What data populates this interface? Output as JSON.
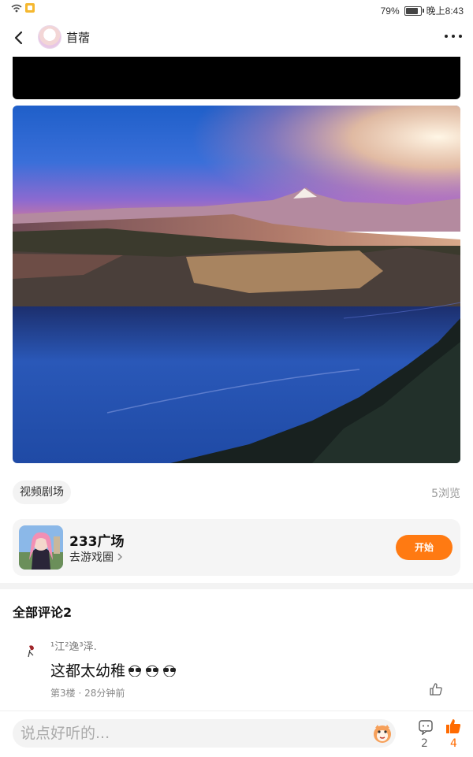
{
  "status_bar": {
    "battery": "79%",
    "time": "晚上8:43",
    "battery_level": 0.79
  },
  "header": {
    "author": "苜蓿"
  },
  "post": {
    "tag": "视频剧场",
    "views": "5浏览"
  },
  "game_card": {
    "title": "233广场",
    "subtitle": "去游戏圈",
    "button": "开始"
  },
  "comments": {
    "header": "全部评论2",
    "items": [
      {
        "user": "¹江²逸³泽.",
        "text": "这都太幼稚",
        "meta": "第3楼 · 28分钟前"
      }
    ]
  },
  "bottom_bar": {
    "placeholder": "说点好听的...",
    "comment_count": "2",
    "like_count": "4"
  },
  "colors": {
    "accent": "#ff7a12",
    "like_active": "#ff6a00"
  }
}
